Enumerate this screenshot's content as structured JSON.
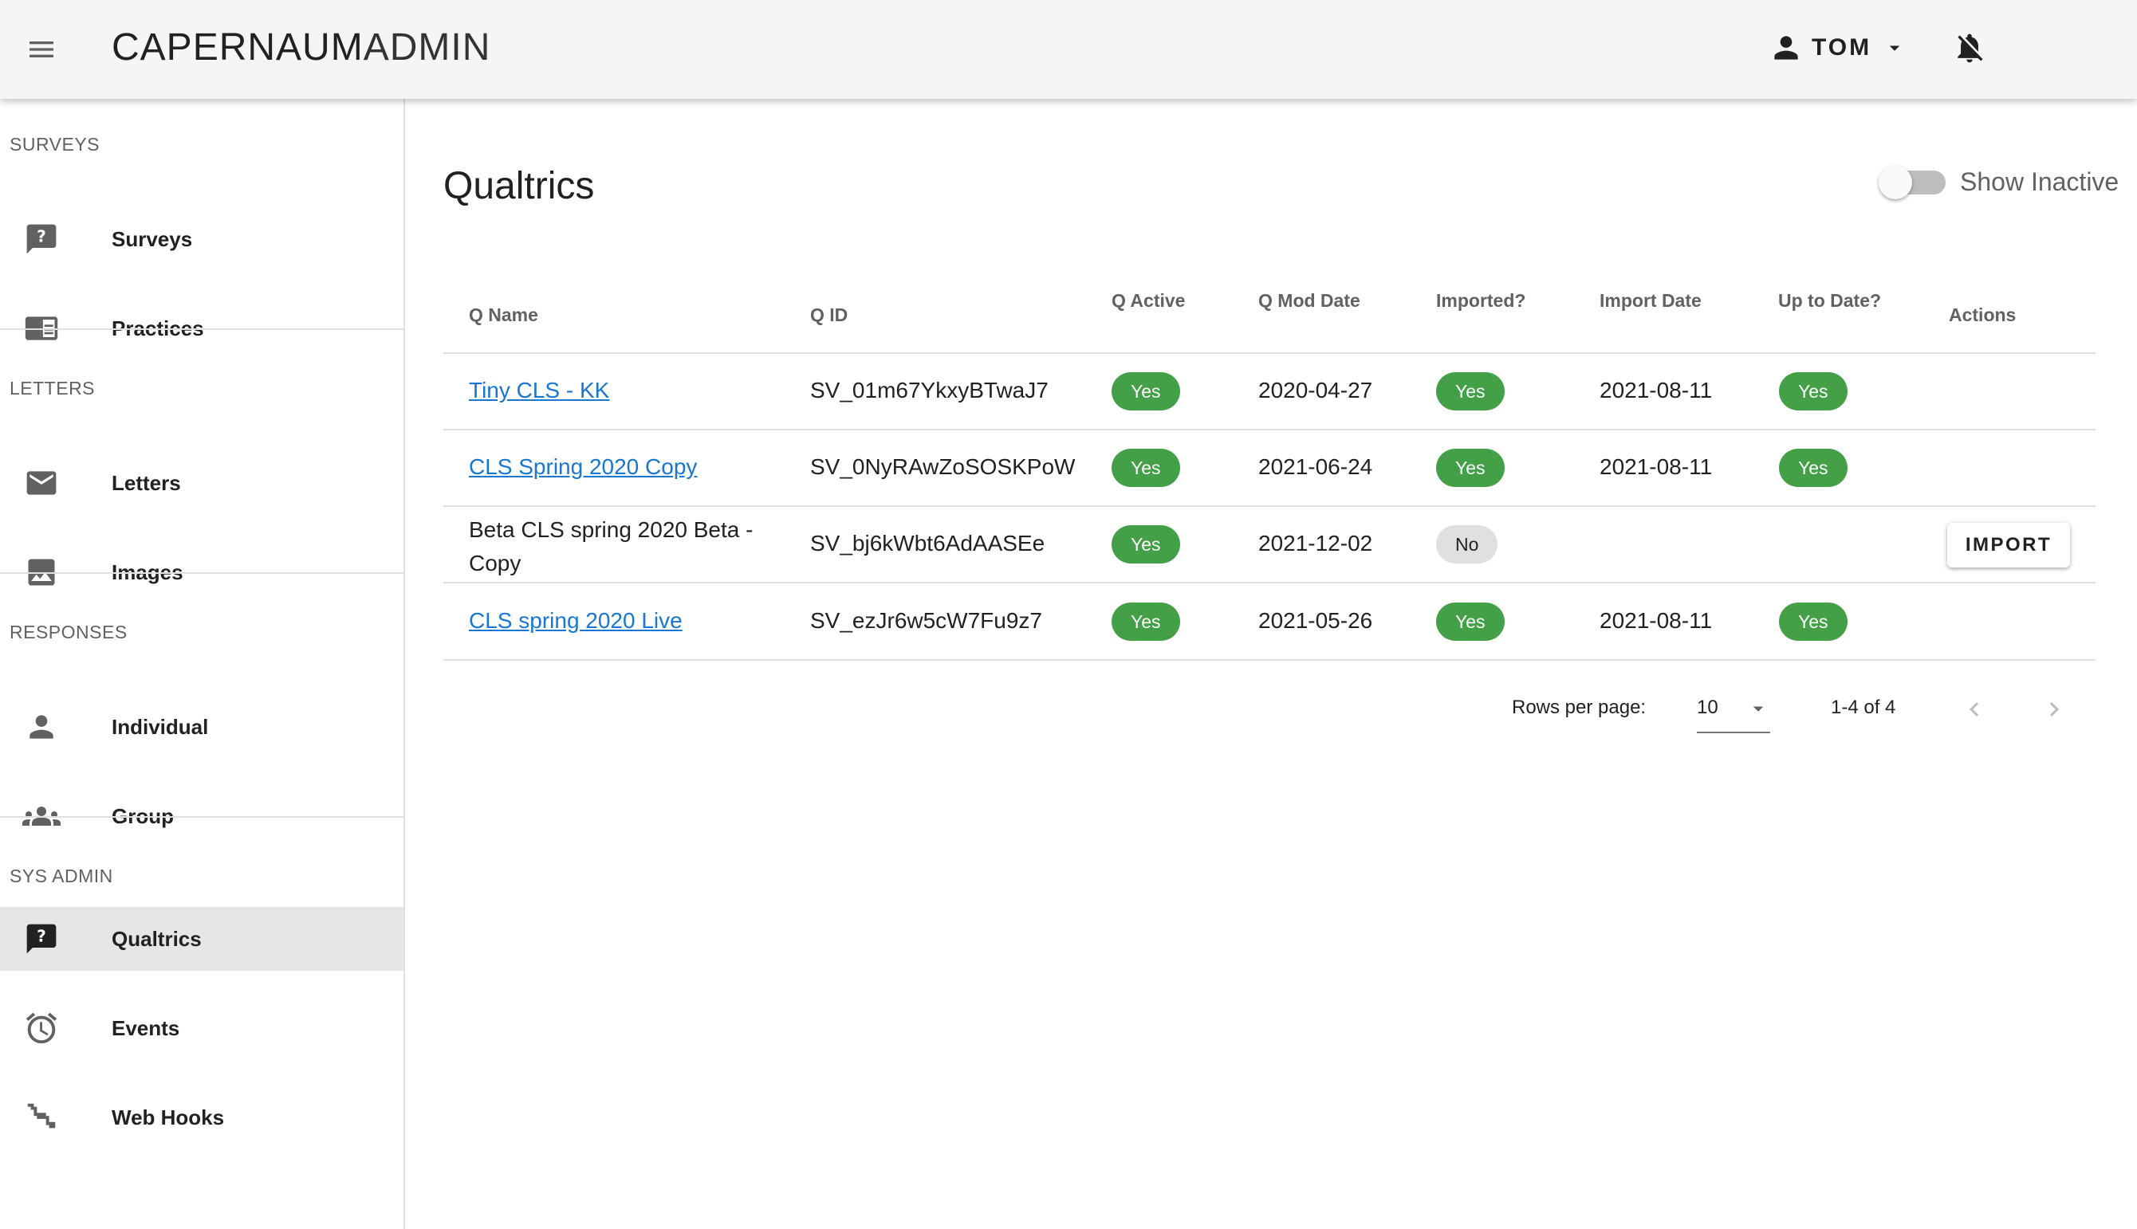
{
  "appbar": {
    "title_bold": "CAPERNAUM",
    "title_light": "ADMIN",
    "user_name": "TOM"
  },
  "sidebar": {
    "sections": [
      {
        "label": "SURVEYS",
        "items": [
          {
            "label": "Surveys",
            "icon": "survey-question-icon"
          },
          {
            "label": "Practices",
            "icon": "practices-icon"
          }
        ]
      },
      {
        "label": "LETTERS",
        "items": [
          {
            "label": "Letters",
            "icon": "mail-icon"
          },
          {
            "label": "Images",
            "icon": "image-icon"
          }
        ]
      },
      {
        "label": "RESPONSES",
        "items": [
          {
            "label": "Individual",
            "icon": "person-icon"
          },
          {
            "label": "Group",
            "icon": "group-icon"
          }
        ]
      },
      {
        "label": "SYS ADMIN",
        "items": [
          {
            "label": "Qualtrics",
            "icon": "qualtrics-icon",
            "active": true
          },
          {
            "label": "Events",
            "icon": "alarm-icon"
          },
          {
            "label": "Web Hooks",
            "icon": "webhook-icon"
          }
        ]
      }
    ]
  },
  "main": {
    "title": "Qualtrics",
    "show_inactive_label": "Show Inactive",
    "show_inactive": false,
    "columns": [
      "Q Name",
      "Q ID",
      "Q Active",
      "Q Mod Date",
      "Imported?",
      "Import Date",
      "Up to Date?",
      "Actions"
    ],
    "rows": [
      {
        "name": "Tiny CLS - KK",
        "name_is_link": true,
        "id": "SV_01m67YkxyBTwaJ7",
        "active": "Yes",
        "mod_date": "2020-04-27",
        "imported": "Yes",
        "import_date": "2021-08-11",
        "up_to_date": "Yes",
        "action": ""
      },
      {
        "name": "CLS Spring 2020 Copy",
        "name_is_link": true,
        "id": "SV_0NyRAwZoSOSKPoW",
        "active": "Yes",
        "mod_date": "2021-06-24",
        "imported": "Yes",
        "import_date": "2021-08-11",
        "up_to_date": "Yes",
        "action": ""
      },
      {
        "name_line1": "Beta CLS spring 2020 Beta -",
        "name_line2": "Copy",
        "name_is_link": false,
        "id": "SV_bj6kWbt6AdAASEe",
        "active": "Yes",
        "mod_date": "2021-12-02",
        "imported": "No",
        "import_date": "",
        "up_to_date": "",
        "action": "IMPORT"
      },
      {
        "name": "CLS spring 2020 Live",
        "name_is_link": true,
        "id": "SV_ezJr6w5cW7Fu9z7",
        "active": "Yes",
        "mod_date": "2021-05-26",
        "imported": "Yes",
        "import_date": "2021-08-11",
        "up_to_date": "Yes",
        "action": ""
      }
    ],
    "pagination": {
      "rows_per_page_label": "Rows per page:",
      "rows_per_page": "10",
      "range": "1-4 of 4"
    }
  },
  "colors": {
    "chip_yes": "#43a047",
    "chip_no": "#e0e0e0",
    "link": "#1976d2",
    "active_nav": "#e6e6e6"
  }
}
